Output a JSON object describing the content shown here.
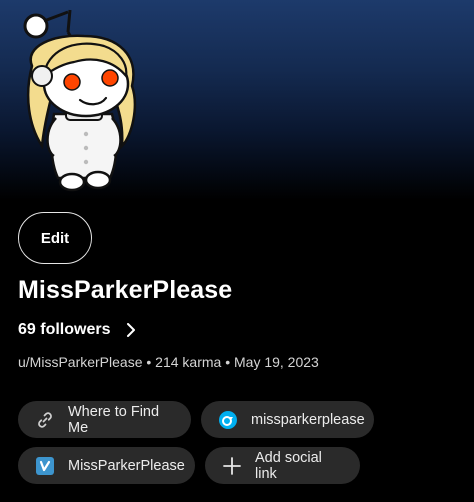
{
  "profile": {
    "edit_label": "Edit",
    "username": "MissParkerPlease",
    "followers_label": "69 followers",
    "meta_line": "u/MissParkerPlease • 214 karma • May 19, 2023"
  },
  "social_links": [
    {
      "label": "Where to Find Me",
      "icon": "link-icon"
    },
    {
      "label": "missparkerplease",
      "icon": "onlyfans-icon"
    },
    {
      "label": "MissParkerPlease",
      "icon": "venmo-icon"
    },
    {
      "label": "Add social link",
      "icon": "plus-icon"
    }
  ],
  "colors": {
    "banner_top": "#1d3a6b",
    "chip_bg": "#2a2a2a",
    "onlyfans_blue": "#00aff0",
    "venmo_blue": "#3d95ce"
  }
}
